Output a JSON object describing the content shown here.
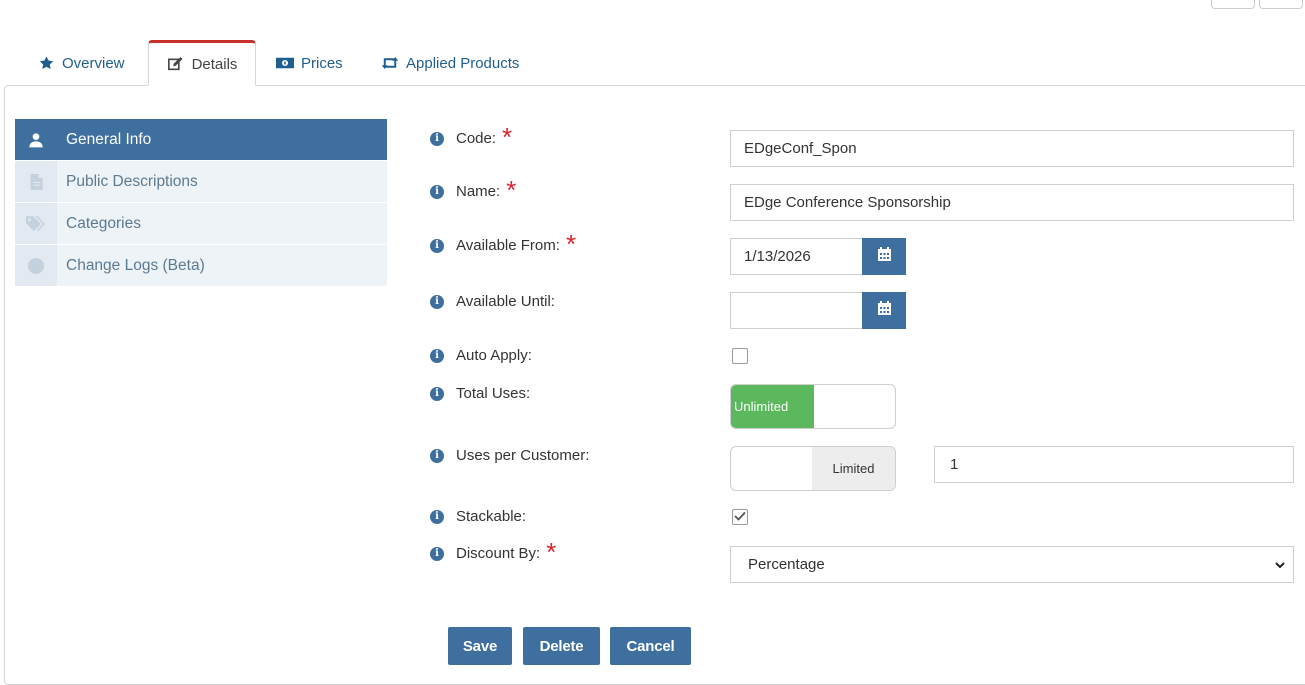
{
  "tabs": [
    {
      "label": "Overview",
      "icon": "star-icon"
    },
    {
      "label": "Details",
      "icon": "edit-icon",
      "active": true
    },
    {
      "label": "Prices",
      "icon": "money-icon"
    },
    {
      "label": "Applied Products",
      "icon": "retweet-icon"
    }
  ],
  "sidenav": [
    {
      "label": "General Info",
      "icon": "user-icon",
      "active": true
    },
    {
      "label": "Public Descriptions",
      "icon": "document-icon"
    },
    {
      "label": "Categories",
      "icon": "tags-icon"
    },
    {
      "label": "Change Logs (Beta)",
      "icon": "circle-icon"
    }
  ],
  "form": {
    "code_label": "Code:",
    "code_value": "EDgeConf_Spon",
    "name_label": "Name:",
    "name_value": "EDge Conference Sponsorship",
    "available_from_label": "Available From:",
    "available_from_value": "1/13/2026",
    "available_until_label": "Available Until:",
    "available_until_value": "",
    "auto_apply_label": "Auto Apply:",
    "auto_apply_checked": false,
    "total_uses_label": "Total Uses:",
    "total_uses_toggle": "Unlimited",
    "uses_per_customer_label": "Uses per Customer:",
    "uses_per_customer_toggle": "Limited",
    "uses_per_customer_value": "1",
    "stackable_label": "Stackable:",
    "stackable_checked": true,
    "discount_by_label": "Discount By:",
    "discount_by_value": "Percentage",
    "required_mark": "*",
    "info_mark": "i"
  },
  "buttons": {
    "save": "Save",
    "delete": "Delete",
    "cancel": "Cancel"
  },
  "colors": {
    "primary": "#3e6f9e",
    "tab_active_border": "#c9302c",
    "toggle_on": "#5cb85c",
    "required": "#d9232d"
  }
}
